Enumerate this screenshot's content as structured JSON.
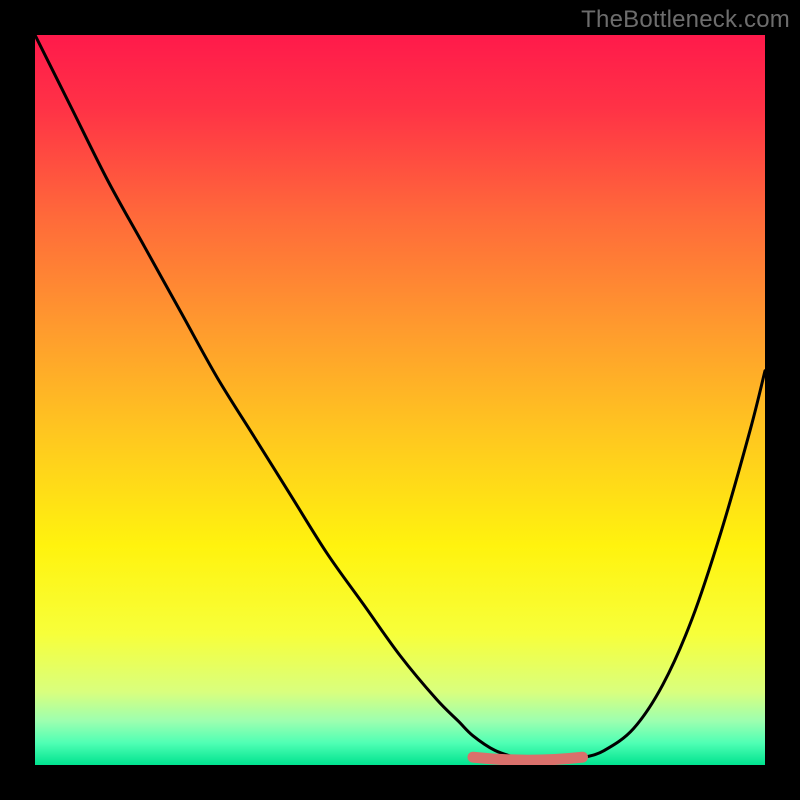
{
  "watermark": "TheBottleneck.com",
  "colors": {
    "frame": "#000000",
    "watermark": "#6d6d6d",
    "curve": "#000000",
    "marker": "#d9706b",
    "gradient_stops": [
      {
        "offset": 0.0,
        "color": "#ff1a4b"
      },
      {
        "offset": 0.1,
        "color": "#ff3246"
      },
      {
        "offset": 0.25,
        "color": "#ff6a3a"
      },
      {
        "offset": 0.4,
        "color": "#ff9a2e"
      },
      {
        "offset": 0.55,
        "color": "#ffc81f"
      },
      {
        "offset": 0.7,
        "color": "#fff30e"
      },
      {
        "offset": 0.82,
        "color": "#f7ff3a"
      },
      {
        "offset": 0.9,
        "color": "#d9ff7e"
      },
      {
        "offset": 0.94,
        "color": "#9cffb0"
      },
      {
        "offset": 0.97,
        "color": "#4fffb4"
      },
      {
        "offset": 1.0,
        "color": "#00e38f"
      }
    ]
  },
  "chart_data": {
    "type": "line",
    "title": "",
    "xlabel": "",
    "ylabel": "",
    "xlim": [
      0,
      100
    ],
    "ylim": [
      0,
      100
    ],
    "categories_note": "x is normalized 0–100 left→right; y is normalized 0–100 top→bottom (0 = top of plot, 100 = bottom baseline)",
    "series": [
      {
        "name": "bottleneck-curve",
        "x": [
          0,
          5,
          10,
          15,
          20,
          25,
          30,
          35,
          40,
          45,
          50,
          55,
          58,
          60,
          63,
          66,
          69,
          72,
          75,
          78,
          82,
          86,
          90,
          94,
          98,
          100
        ],
        "y": [
          0,
          10,
          20,
          29,
          38,
          47,
          55,
          63,
          71,
          78,
          85,
          91,
          94,
          96,
          98,
          99,
          99.5,
          99.5,
          99,
          98,
          95,
          89,
          80,
          68,
          54,
          46
        ]
      }
    ],
    "annotations": [
      {
        "name": "flat-minimum-marker",
        "shape": "rounded-segment",
        "x_range": [
          60,
          75
        ],
        "y": 99.2,
        "color": "#d9706b"
      }
    ]
  }
}
